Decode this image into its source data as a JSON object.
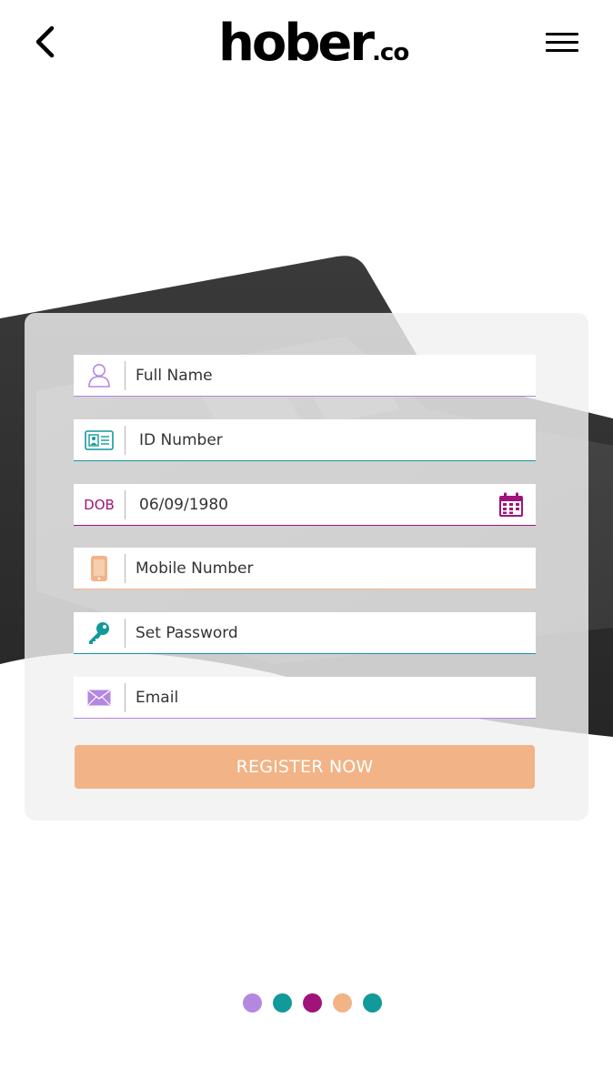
{
  "header": {
    "logo_main": "hober",
    "logo_suffix": ".co",
    "back_icon": "chevron-left-icon",
    "menu_icon": "hamburger-menu-icon"
  },
  "form": {
    "full_name_placeholder": "Full Name",
    "id_number_placeholder": "ID Number",
    "dob_label": "DOB",
    "dob_value": "06/09/1980",
    "mobile_placeholder": "Mobile Number",
    "password_placeholder": "Set Password",
    "email_placeholder": "Email",
    "register_label": "REGISTER NOW"
  },
  "colors": {
    "purple": "#b487e0",
    "teal": "#12999a",
    "magenta": "#a0137a",
    "orange": "#f2b386"
  },
  "pagination": {
    "dots": [
      "#b487e0",
      "#12999a",
      "#a0137a",
      "#f2b386",
      "#12999a"
    ]
  }
}
